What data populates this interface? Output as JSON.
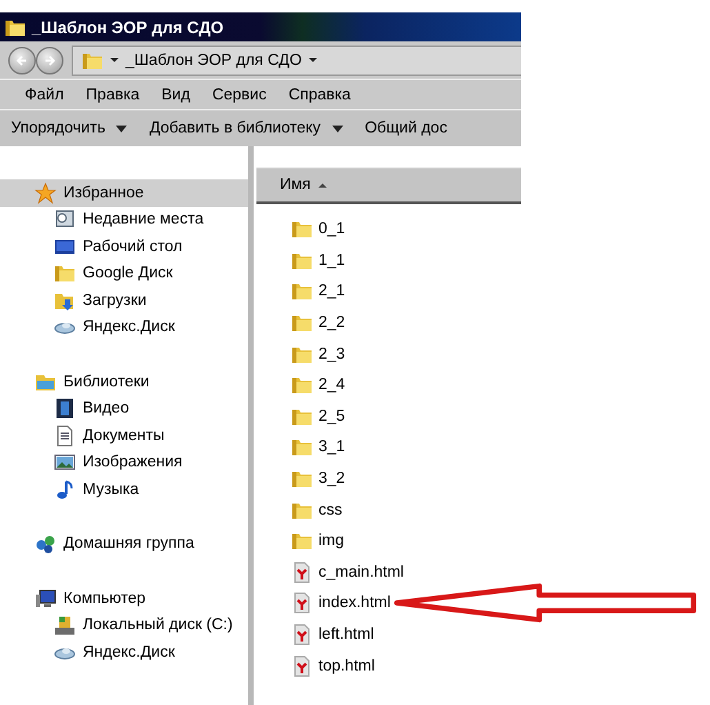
{
  "window": {
    "title": "_Шаблон ЭОР для СДО"
  },
  "address_bar": {
    "path": "_Шаблон ЭОР для СДО"
  },
  "menu": [
    "Файл",
    "Правка",
    "Вид",
    "Сервис",
    "Справка"
  ],
  "toolbar": [
    {
      "label": "Упорядочить",
      "dropdown": true
    },
    {
      "label": "Добавить в библиотеку",
      "dropdown": true
    },
    {
      "label": "Общий дос",
      "dropdown": false
    }
  ],
  "sidebar": {
    "groups": [
      {
        "label": "Избранное",
        "kind": "star",
        "selected": true,
        "children": [
          {
            "label": "Недавние места",
            "kind": "recent",
            "selected": false
          },
          {
            "label": "Рабочий стол",
            "kind": "desktop",
            "selected": false
          },
          {
            "label": "Google Диск",
            "kind": "folder",
            "selected": false
          },
          {
            "label": "Загрузки",
            "kind": "download",
            "selected": false
          },
          {
            "label": "Яндекс.Диск",
            "kind": "cloud",
            "selected": false
          }
        ]
      },
      {
        "label": "Библиотеки",
        "kind": "library",
        "selected": false,
        "children": [
          {
            "label": "Видео",
            "kind": "video",
            "selected": false
          },
          {
            "label": "Документы",
            "kind": "document",
            "selected": false
          },
          {
            "label": "Изображения",
            "kind": "image",
            "selected": false
          },
          {
            "label": "Музыка",
            "kind": "music",
            "selected": false
          }
        ]
      },
      {
        "label": "Домашняя группа",
        "kind": "homegroup",
        "selected": false
      },
      {
        "label": "Компьютер",
        "kind": "computer",
        "selected": false,
        "children": [
          {
            "label": "Локальный диск (C:)",
            "kind": "drive",
            "selected": false
          },
          {
            "label": "Яндекс.Диск",
            "kind": "cloud",
            "selected": false
          }
        ]
      }
    ]
  },
  "file_list": {
    "column": "Имя",
    "sorted_ascending": true,
    "items": [
      {
        "name": "0_1",
        "kind": "folder",
        "pointed": false
      },
      {
        "name": "1_1",
        "kind": "folder",
        "pointed": false
      },
      {
        "name": "2_1",
        "kind": "folder",
        "pointed": false
      },
      {
        "name": "2_2",
        "kind": "folder",
        "pointed": false
      },
      {
        "name": "2_3",
        "kind": "folder",
        "pointed": false
      },
      {
        "name": "2_4",
        "kind": "folder",
        "pointed": false
      },
      {
        "name": "2_5",
        "kind": "folder",
        "pointed": false
      },
      {
        "name": "3_1",
        "kind": "folder",
        "pointed": false
      },
      {
        "name": "3_2",
        "kind": "folder",
        "pointed": false
      },
      {
        "name": "css",
        "kind": "folder",
        "pointed": false
      },
      {
        "name": "img",
        "kind": "folder",
        "pointed": false
      },
      {
        "name": "c_main.html",
        "kind": "html",
        "pointed": false
      },
      {
        "name": "index.html",
        "kind": "html",
        "pointed": true
      },
      {
        "name": "left.html",
        "kind": "html",
        "pointed": false
      },
      {
        "name": "top.html",
        "kind": "html",
        "pointed": false
      }
    ]
  }
}
